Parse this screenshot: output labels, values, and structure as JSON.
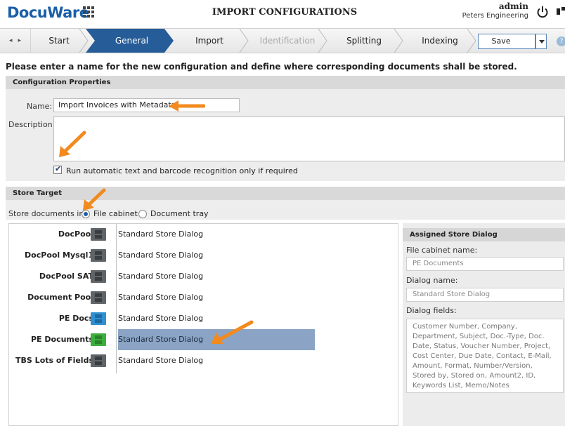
{
  "header": {
    "logo": "DocuWare",
    "title": "IMPORT CONFIGURATIONS",
    "user": "admin",
    "organization": "Peters Engineering"
  },
  "wizard": {
    "steps": [
      {
        "label": "Start",
        "state": "done"
      },
      {
        "label": "General",
        "state": "active"
      },
      {
        "label": "Import",
        "state": "normal"
      },
      {
        "label": "Identification",
        "state": "disabled"
      },
      {
        "label": "Splitting",
        "state": "normal"
      },
      {
        "label": "Indexing",
        "state": "normal"
      }
    ],
    "save_label": "Save"
  },
  "instruction": "Please enter a name for the new configuration and define where corresponding documents shall be stored.",
  "config_properties": {
    "heading": "Configuration Properties",
    "name_label": "Name:",
    "name_value": "Import Invoices with Metadata",
    "description_label": "Description:",
    "description_value": "",
    "recognition_checkbox_label": "Run automatic text and barcode recognition only if required",
    "recognition_checked": true
  },
  "store_target": {
    "heading": "Store Target",
    "store_in_label": "Store documents in:",
    "options": [
      {
        "label": "File cabinet",
        "selected": true
      },
      {
        "label": "Document tray",
        "selected": false
      }
    ]
  },
  "cabinets": [
    {
      "name": "DocPool",
      "dialog": "Standard Store Dialog",
      "icon": "file-cabinet-gray-icon",
      "color": "#5f6469",
      "selected": false
    },
    {
      "name": "DocPool Mysql1",
      "dialog": "Standard Store Dialog",
      "icon": "file-cabinet-gray-icon",
      "color": "#5f6469",
      "selected": false
    },
    {
      "name": "DocPool SAT",
      "dialog": "Standard Store Dialog",
      "icon": "file-cabinet-gray-icon",
      "color": "#5f6469",
      "selected": false
    },
    {
      "name": "Document Pool",
      "dialog": "Standard Store Dialog",
      "icon": "file-cabinet-gray-icon",
      "color": "#5f6469",
      "selected": false
    },
    {
      "name": "PE Docs",
      "dialog": "Standard Store Dialog",
      "icon": "file-cabinet-blue-icon",
      "color": "#2f8fd0",
      "selected": false
    },
    {
      "name": "PE Documents",
      "dialog": "Standard Store Dialog",
      "icon": "file-cabinet-green-icon",
      "color": "#3cae3c",
      "selected": true
    },
    {
      "name": "TBS Lots of Fields",
      "dialog": "Standard Store Dialog",
      "icon": "file-cabinet-gray-icon",
      "color": "#5f6469",
      "selected": false
    }
  ],
  "assigned_store_dialog": {
    "heading": "Assigned Store Dialog",
    "cabinet_label": "File cabinet name:",
    "cabinet_value": "PE Documents",
    "dialog_label": "Dialog name:",
    "dialog_value": "Standard Store Dialog",
    "fields_label": "Dialog fields:",
    "fields_value": "Customer Number, Company, Department, Subject, Doc.-Type, Doc. Date, Status, Voucher Number, Project, Cost Center, Due Date, Contact, E-Mail, Amount, Format, Number/Version, Stored by, Stored on, Amount2, ID, Keywords List, Memo/Notes"
  },
  "colors": {
    "brand_blue": "#1a5fa8",
    "active_step": "#265d98",
    "annotation_arrow": "#f28a1e",
    "selection": "#8ba4c5"
  }
}
